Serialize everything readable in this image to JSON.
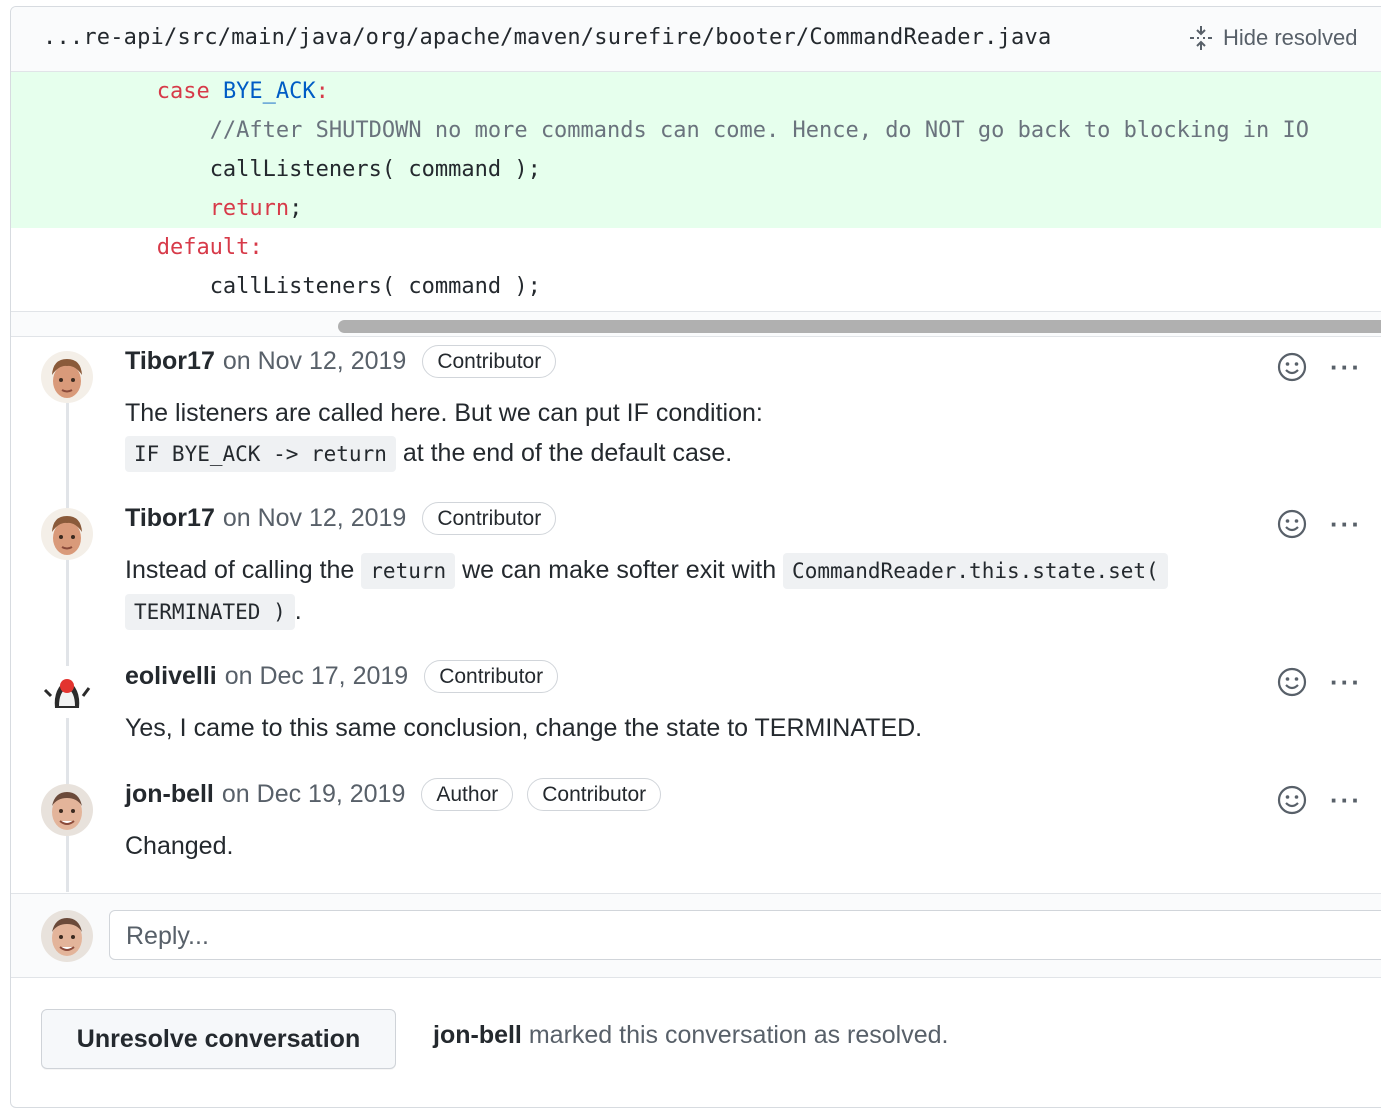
{
  "file": {
    "path": "...re-api/src/main/java/org/apache/maven/surefire/booter/CommandReader.java",
    "hide_resolved_label": "Hide resolved"
  },
  "code_lines": [
    {
      "added": true,
      "tokens": [
        {
          "t": "kw",
          "v": "case"
        },
        {
          "t": "plain",
          "v": " "
        },
        {
          "t": "const",
          "v": "BYE_ACK"
        },
        {
          "t": "kw",
          "v": ":"
        }
      ],
      "indent": "        "
    },
    {
      "added": true,
      "tokens": [
        {
          "t": "com",
          "v": "//After SHUTDOWN no more commands can come. Hence, do NOT go back to blocking in IO"
        }
      ],
      "indent": "            "
    },
    {
      "added": true,
      "tokens": [
        {
          "t": "plain",
          "v": "callListeners( command );"
        }
      ],
      "indent": "            "
    },
    {
      "added": true,
      "tokens": [
        {
          "t": "kw",
          "v": "return"
        },
        {
          "t": "plain",
          "v": ";"
        }
      ],
      "indent": "            "
    },
    {
      "added": false,
      "tokens": [
        {
          "t": "kw",
          "v": "default:"
        }
      ],
      "indent": "        "
    },
    {
      "added": false,
      "tokens": [
        {
          "t": "plain",
          "v": "callListeners( command );"
        }
      ],
      "indent": "            "
    }
  ],
  "comments": [
    {
      "author": "Tibor17",
      "date": "on Nov 12, 2019",
      "badges": [
        "Contributor"
      ],
      "avatar": "avatar-tibor17",
      "body": [
        [
          {
            "text": "The listeners are called here. But we can put IF condition:"
          }
        ],
        [
          {
            "code": "IF BYE_ACK -> return"
          },
          {
            "text": " at the end of the default case."
          }
        ]
      ]
    },
    {
      "author": "Tibor17",
      "date": "on Nov 12, 2019",
      "badges": [
        "Contributor"
      ],
      "avatar": "avatar-tibor17",
      "body": [
        [
          {
            "text": "Instead of calling the "
          },
          {
            "code": "return"
          },
          {
            "text": " we can make softer exit with "
          },
          {
            "code": "CommandReader.this.state.set("
          }
        ],
        [
          {
            "code": "TERMINATED )"
          },
          {
            "text": "."
          }
        ]
      ]
    },
    {
      "author": "eolivelli",
      "date": "on Dec 17, 2019",
      "badges": [
        "Contributor"
      ],
      "avatar": "avatar-eolivelli",
      "body": [
        [
          {
            "text": "Yes, I came to this same conclusion, change the state to TERMINATED."
          }
        ]
      ]
    },
    {
      "author": "jon-bell",
      "date": "on Dec 19, 2019",
      "badges": [
        "Author",
        "Contributor"
      ],
      "avatar": "avatar-jon-bell",
      "body": [
        [
          {
            "text": "Changed."
          }
        ]
      ]
    }
  ],
  "reply": {
    "placeholder": "Reply..."
  },
  "resolution": {
    "button_label": "Unresolve conversation",
    "resolver": "jon-bell",
    "message": "marked this conversation as resolved."
  },
  "more_label": "···"
}
